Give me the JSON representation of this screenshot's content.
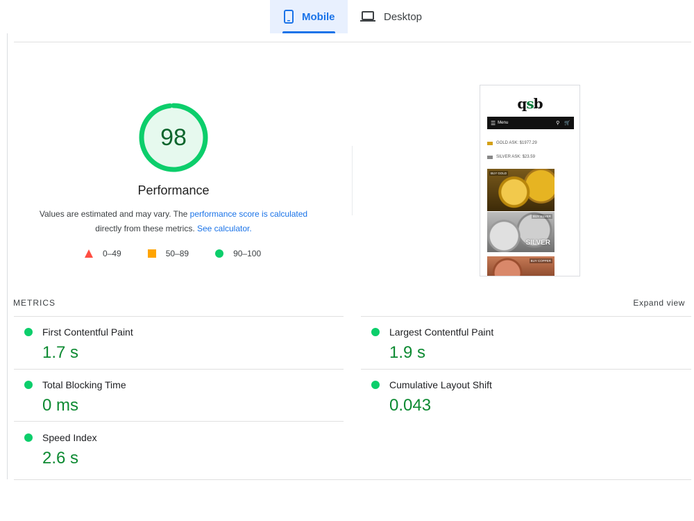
{
  "tabs": [
    {
      "label": "Mobile",
      "icon": "smartphone-icon",
      "active": true
    },
    {
      "label": "Desktop",
      "icon": "laptop-icon",
      "active": false
    }
  ],
  "gauge": {
    "score": "98",
    "score_value": 98,
    "title": "Performance",
    "description_prefix": "Values are estimated and may vary. The ",
    "description_link1": "performance score is calculated",
    "description_middle": "directly from these metrics. ",
    "description_link2": "See calculator."
  },
  "legend": [
    {
      "range": "0–49",
      "shape": "triangle",
      "color": "#ff4e42"
    },
    {
      "range": "50–89",
      "shape": "square",
      "color": "#ffa400"
    },
    {
      "range": "90–100",
      "shape": "circle",
      "color": "#0cce6b"
    }
  ],
  "screenshot": {
    "logo_left": "q",
    "logo_mid": "s",
    "logo_right": "b",
    "menu_label": "Menu",
    "gold_ask": "GOLD ASK: $1977.29",
    "silver_ask": "SILVER ASK: $23.59",
    "gold_tag": "BUY GOLD",
    "silver_tag": "BUY SILVER",
    "silver_big": "SILVER",
    "copper_tag": "BUY COPPER"
  },
  "metrics": {
    "title": "METRICS",
    "expand_label": "Expand view",
    "items": [
      {
        "label": "First Contentful Paint",
        "value": "1.7 s"
      },
      {
        "label": "Largest Contentful Paint",
        "value": "1.9 s"
      },
      {
        "label": "Total Blocking Time",
        "value": "0 ms"
      },
      {
        "label": "Cumulative Layout Shift",
        "value": "0.043"
      },
      {
        "label": "Speed Index",
        "value": "2.6 s"
      }
    ]
  },
  "colors": {
    "accent": "#1a73e8",
    "pass": "#0cce6b",
    "pass_text": "#0d8a32",
    "average": "#ffa400",
    "fail": "#ff4e42"
  }
}
